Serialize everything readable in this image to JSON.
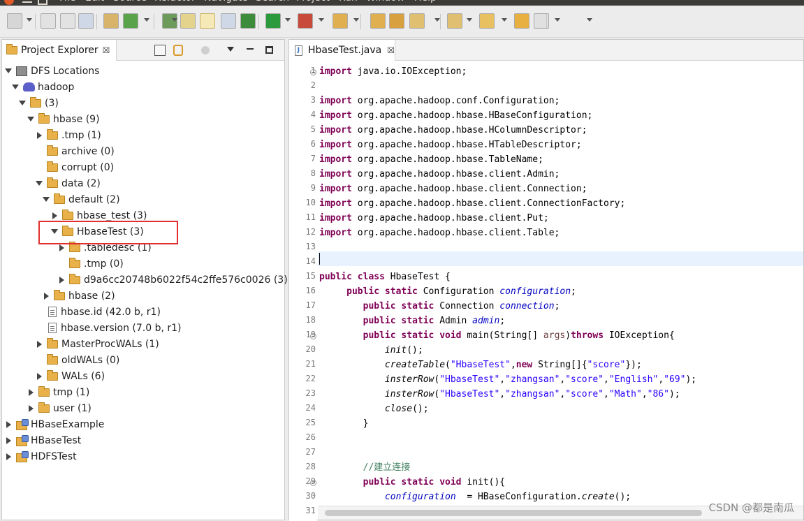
{
  "menubar": {
    "items": [
      "File",
      "Edit",
      "Source",
      "Refactor",
      "Navigate",
      "Search",
      "Project",
      "Run",
      "Window",
      "Help"
    ]
  },
  "toolbar": {
    "icons": [
      "new-icon",
      "save-icon",
      "save-all-icon",
      "print-icon",
      "new-java-project-icon",
      "new-class-icon",
      "open-type-icon",
      "mark-occurrences-icon",
      "toggle-breadcrumb-icon",
      "show-whitespace-icon",
      "debug-icon",
      "run-icon",
      "run-last-icon",
      "open-folder-icon",
      "open-folder-2-icon",
      "search-icon",
      "next-annotation-icon",
      "prev-annotation-icon",
      "last-edit-icon",
      "back-icon",
      "forward-icon"
    ]
  },
  "explorer": {
    "title": "Project Explorer",
    "close": "☒",
    "tree": [
      {
        "label": "DFS Locations",
        "icon": "dfs",
        "state": "open",
        "depth": 0
      },
      {
        "label": "hadoop",
        "icon": "elephant",
        "state": "open",
        "depth": 1
      },
      {
        "label": "(3)",
        "icon": "folder",
        "state": "open",
        "depth": 2
      },
      {
        "label": "hbase (9)",
        "icon": "folder",
        "state": "open",
        "depth": 3
      },
      {
        "label": ".tmp (1)",
        "icon": "folder",
        "state": "closed",
        "depth": 4
      },
      {
        "label": "archive (0)",
        "icon": "folder",
        "state": "none",
        "depth": 4
      },
      {
        "label": "corrupt (0)",
        "icon": "folder",
        "state": "none",
        "depth": 4
      },
      {
        "label": "data (2)",
        "icon": "folder",
        "state": "open",
        "depth": 4
      },
      {
        "label": "default (2)",
        "icon": "folder",
        "state": "open",
        "depth": 5
      },
      {
        "label": "hbase_test (3)",
        "icon": "folder",
        "state": "closed",
        "depth": 6
      },
      {
        "label": "HbaseTest (3)",
        "icon": "folder",
        "state": "open",
        "depth": 6
      },
      {
        "label": ".tabledesc (1)",
        "icon": "folder",
        "state": "closed",
        "depth": 7
      },
      {
        "label": ".tmp (0)",
        "icon": "folder",
        "state": "none",
        "depth": 7
      },
      {
        "label": "d9a6cc20748b6022f54c2ffe576c0026 (3)",
        "icon": "folder",
        "state": "closed",
        "depth": 7
      },
      {
        "label": "hbase (2)",
        "icon": "folder",
        "state": "closed",
        "depth": 5
      },
      {
        "label": "hbase.id (42.0 b, r1)",
        "icon": "file",
        "state": "none",
        "depth": 4
      },
      {
        "label": "hbase.version (7.0 b, r1)",
        "icon": "file",
        "state": "none",
        "depth": 4
      },
      {
        "label": "MasterProcWALs (1)",
        "icon": "folder",
        "state": "closed",
        "depth": 4
      },
      {
        "label": "oldWALs (0)",
        "icon": "folder",
        "state": "none",
        "depth": 4
      },
      {
        "label": "WALs (6)",
        "icon": "folder",
        "state": "closed",
        "depth": 4
      },
      {
        "label": "tmp (1)",
        "icon": "folder",
        "state": "closed",
        "depth": 3
      },
      {
        "label": "user (1)",
        "icon": "folder",
        "state": "closed",
        "depth": 3
      },
      {
        "label": "HBaseExample",
        "icon": "project",
        "state": "closed",
        "depth": 0
      },
      {
        "label": "HBaseTest",
        "icon": "project",
        "state": "closed",
        "depth": 0
      },
      {
        "label": "HDFSTest",
        "icon": "project",
        "state": "closed",
        "depth": 0
      }
    ]
  },
  "editor": {
    "tab_title": "HbaseTest.java",
    "close": "☒",
    "current_line": 14,
    "lines": [
      {
        "n": "1",
        "fold": true,
        "code": [
          [
            "kw",
            "import"
          ],
          [
            "",
            "java.io.IOException;"
          ]
        ]
      },
      {
        "n": "2",
        "code": []
      },
      {
        "n": "3",
        "code": [
          [
            "kw",
            "import"
          ],
          [
            "",
            "org.apache.hadoop.conf.Configuration;"
          ]
        ]
      },
      {
        "n": "4",
        "code": [
          [
            "kw",
            "import"
          ],
          [
            "",
            "org.apache.hadoop.hbase.HBaseConfiguration;"
          ]
        ]
      },
      {
        "n": "5",
        "code": [
          [
            "kw",
            "import"
          ],
          [
            "",
            "org.apache.hadoop.hbase.HColumnDescriptor;"
          ]
        ]
      },
      {
        "n": "6",
        "code": [
          [
            "kw",
            "import"
          ],
          [
            "",
            "org.apache.hadoop.hbase.HTableDescriptor;"
          ]
        ]
      },
      {
        "n": "7",
        "code": [
          [
            "kw",
            "import"
          ],
          [
            "",
            "org.apache.hadoop.hbase.TableName;"
          ]
        ]
      },
      {
        "n": "8",
        "code": [
          [
            "kw",
            "import"
          ],
          [
            "",
            "org.apache.hadoop.hbase.client.Admin;"
          ]
        ]
      },
      {
        "n": "9",
        "code": [
          [
            "kw",
            "import"
          ],
          [
            "",
            "org.apache.hadoop.hbase.client.Connection;"
          ]
        ]
      },
      {
        "n": "10",
        "code": [
          [
            "kw",
            "import"
          ],
          [
            "",
            "org.apache.hadoop.hbase.client.ConnectionFactory;"
          ]
        ]
      },
      {
        "n": "11",
        "code": [
          [
            "kw",
            "import"
          ],
          [
            "",
            "org.apache.hadoop.hbase.client.Put;"
          ]
        ]
      },
      {
        "n": "12",
        "code": [
          [
            "kw",
            "import"
          ],
          [
            "",
            "org.apache.hadoop.hbase.client.Table;"
          ]
        ]
      },
      {
        "n": "13",
        "code": []
      },
      {
        "n": "14",
        "code": []
      },
      {
        "n": "15",
        "code": [
          [
            "kw",
            "public class"
          ],
          [
            "",
            " HbaseTest {"
          ]
        ]
      },
      {
        "n": "16",
        "code": [
          [
            "",
            "     "
          ],
          [
            "kw",
            "public static"
          ],
          [
            "",
            " Configuration "
          ],
          [
            "fld",
            "configuration"
          ],
          [
            "",
            ";"
          ]
        ]
      },
      {
        "n": "17",
        "code": [
          [
            "",
            "        "
          ],
          [
            "kw",
            "public static"
          ],
          [
            "",
            " Connection "
          ],
          [
            "fld",
            "connection"
          ],
          [
            "",
            ";"
          ]
        ]
      },
      {
        "n": "18",
        "code": [
          [
            "",
            "        "
          ],
          [
            "kw",
            "public static"
          ],
          [
            "",
            " Admin "
          ],
          [
            "fld",
            "admin"
          ],
          [
            "",
            ";"
          ]
        ]
      },
      {
        "n": "19",
        "fold": true,
        "code": [
          [
            "",
            "        "
          ],
          [
            "kw",
            "public static void"
          ],
          [
            "",
            " main(String[] "
          ],
          [
            "pm",
            "args"
          ],
          [
            "",
            ")"
          ],
          [
            "kw",
            "throws"
          ],
          [
            "",
            " IOException{"
          ]
        ]
      },
      {
        "n": "20",
        "code": [
          [
            "",
            "            "
          ],
          [
            "it",
            "init"
          ],
          [
            "",
            "();"
          ]
        ]
      },
      {
        "n": "21",
        "code": [
          [
            "",
            "            "
          ],
          [
            "it",
            "createTable"
          ],
          [
            "",
            "("
          ],
          [
            "st",
            "\"HbaseTest\""
          ],
          [
            "",
            ","
          ],
          [
            "kw",
            "new"
          ],
          [
            "",
            " String[]{"
          ],
          [
            "st",
            "\"score\""
          ],
          [
            "",
            "});"
          ]
        ]
      },
      {
        "n": "22",
        "code": [
          [
            "",
            "            "
          ],
          [
            "it",
            "insterRow"
          ],
          [
            "",
            "("
          ],
          [
            "st",
            "\"HbaseTest\""
          ],
          [
            "",
            ","
          ],
          [
            "st",
            "\"zhangsan\""
          ],
          [
            "",
            ","
          ],
          [
            "st",
            "\"score\""
          ],
          [
            "",
            ","
          ],
          [
            "st",
            "\"English\""
          ],
          [
            "",
            ","
          ],
          [
            "st",
            "\"69\""
          ],
          [
            "",
            ");"
          ]
        ]
      },
      {
        "n": "23",
        "code": [
          [
            "",
            "            "
          ],
          [
            "it",
            "insterRow"
          ],
          [
            "",
            "("
          ],
          [
            "st",
            "\"HbaseTest\""
          ],
          [
            "",
            ","
          ],
          [
            "st",
            "\"zhangsan\""
          ],
          [
            "",
            ","
          ],
          [
            "st",
            "\"score\""
          ],
          [
            "",
            ","
          ],
          [
            "st",
            "\"Math\""
          ],
          [
            "",
            ","
          ],
          [
            "st",
            "\"86\""
          ],
          [
            "",
            ");"
          ]
        ]
      },
      {
        "n": "24",
        "code": [
          [
            "",
            "            "
          ],
          [
            "it",
            "close"
          ],
          [
            "",
            "();"
          ]
        ]
      },
      {
        "n": "25",
        "code": [
          [
            "",
            "        }"
          ]
        ]
      },
      {
        "n": "26",
        "code": []
      },
      {
        "n": "27",
        "code": []
      },
      {
        "n": "28",
        "code": [
          [
            "",
            "        "
          ],
          [
            "cm",
            "//建立连接"
          ]
        ]
      },
      {
        "n": "29",
        "fold": true,
        "code": [
          [
            "",
            "        "
          ],
          [
            "kw",
            "public static void"
          ],
          [
            "",
            " init(){"
          ]
        ]
      },
      {
        "n": "30",
        "code": [
          [
            "",
            "            "
          ],
          [
            "fld",
            "configuration"
          ],
          [
            "",
            "  = HBaseConfiguration."
          ],
          [
            "it",
            "create"
          ],
          [
            "",
            "();"
          ]
        ]
      },
      {
        "n": "31",
        "code": []
      }
    ]
  },
  "watermark": "CSDN @都是南瓜"
}
